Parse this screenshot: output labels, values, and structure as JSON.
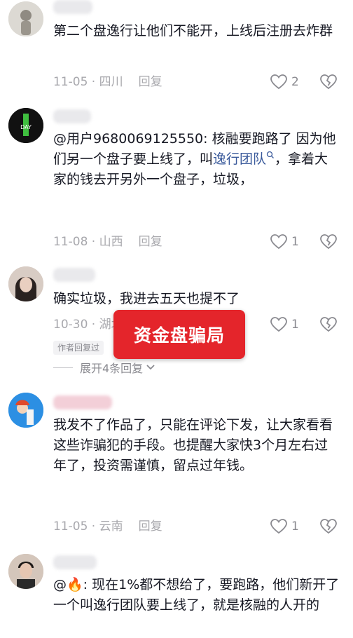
{
  "comments": [
    {
      "text": "第二个盘逸行让他们不能开，上线后注册去炸群",
      "date": "11-05",
      "location": "四川",
      "reply_label": "回复",
      "likes": "2",
      "avatar_icon": "portrait-avatar-icon"
    },
    {
      "mention": "@用户9680069125550:",
      "text_part1": " 核融要跑路了 因为他们另一个盘子要上线了，叫",
      "link": "逸行团队",
      "text_part2": "，拿着大家的钱去开另外一个盘子，垃圾，",
      "date": "11-08",
      "location": "山西",
      "reply_label": "回复",
      "likes": "1",
      "avatar_label": "DAY"
    },
    {
      "text": "确实垃圾，我进去五天也提不了",
      "date": "10-30",
      "location": "湖北",
      "reply_label": "回复",
      "likes": "1",
      "author_badge": "作者回复过",
      "expand_label": "展开4条回复"
    },
    {
      "text": "我发不了作品了，只能在评论下发，让大家看看这些诈骗犯的手段。也提醒大家快3个月左右过年了，投资需谨慎，留点过年钱。",
      "date": "11-05",
      "location": "云南",
      "reply_label": "回复",
      "likes": "1"
    },
    {
      "mention": "@🔥:",
      "text": " 现在1%都不想给了，要跑路，他们新开了一个叫逸行团队要上线了，就是核融的人开的"
    }
  ],
  "overlay_label": "资金盘骗局",
  "colors": {
    "accent_red": "#e4252b",
    "link_blue": "#3a5a9b",
    "meta_gray": "#a8a8ad"
  }
}
